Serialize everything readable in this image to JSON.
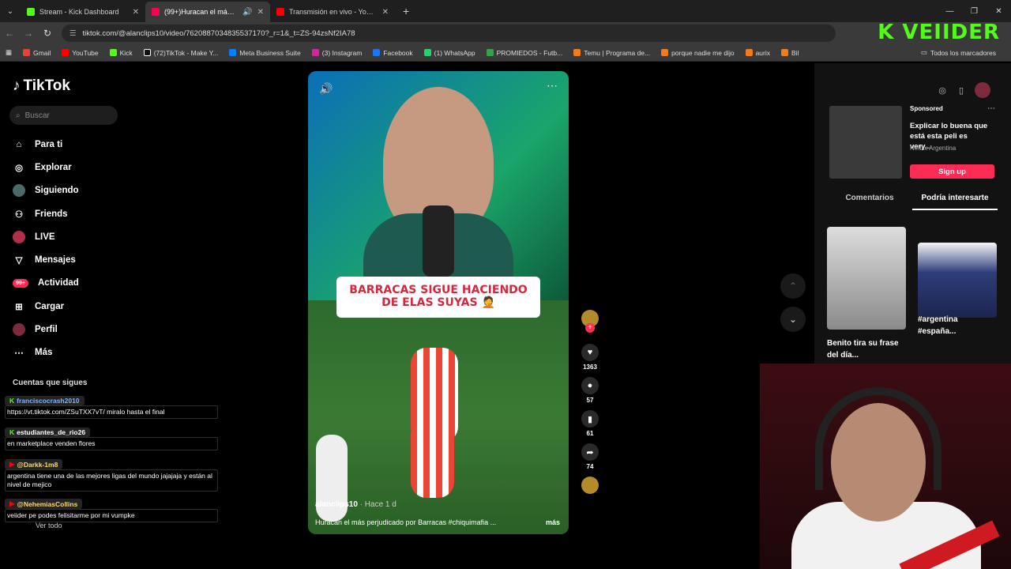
{
  "browser": {
    "tabs": [
      {
        "title": "Stream - Kick Dashboard",
        "color": "#53fc18",
        "active": false
      },
      {
        "title": "(99+)Huracan el más perju",
        "color": "#ff0050",
        "active": true
      },
      {
        "title": "Transmisión en vivo - YouTube",
        "color": "#ff0000",
        "active": false
      }
    ],
    "new_tab": "+",
    "url_host": "tiktok.com/@alanclips10/video/7620887034835537170?_r=1&_t=ZS-94zsNf2IA78",
    "bookmarks": [
      "Gmail",
      "YouTube",
      "Kick",
      "(72)TikTok - Make Y...",
      "Meta Business Suite",
      "(3) Instagram",
      "Facebook",
      "(1) WhatsApp",
      "PROMIEDOS - Futb...",
      "Temu | Programa de...",
      "porque nadie me dijo",
      "aurix",
      "Bil"
    ],
    "all_bookmarks": "Todos los marcadores",
    "overlay_logo": "K VEIIDER"
  },
  "tiktok": {
    "logo": "TikTok",
    "search_placeholder": "Buscar",
    "nav": [
      {
        "label": "Para ti",
        "icon": "home-icon"
      },
      {
        "label": "Explorar",
        "icon": "compass-icon"
      },
      {
        "label": "Siguiendo",
        "icon": "following-avatar-icon"
      },
      {
        "label": "Friends",
        "icon": "friends-icon"
      },
      {
        "label": "LIVE",
        "icon": "live-icon"
      },
      {
        "label": "Mensajes",
        "icon": "messages-icon"
      },
      {
        "label": "Actividad",
        "icon": "activity-icon",
        "badge": "99+"
      },
      {
        "label": "Cargar",
        "icon": "upload-icon"
      },
      {
        "label": "Perfil",
        "icon": "profile-icon"
      },
      {
        "label": "Más",
        "icon": "more-icon"
      }
    ],
    "following_header": "Cuentas que sigues",
    "see_all": "Ver todo"
  },
  "chat": [
    {
      "user": "franciscocrash2010",
      "msg": "https://vt.tiktok.com/ZSuTXX7vT/ miralo hasta el final"
    },
    {
      "user": "estudiantes_de_rio26",
      "msg": "en marketplace venden flores"
    },
    {
      "user": "@Darkk-1m8",
      "msg": "argentina tiene una de las mejores ligas del mundo jajajaja y están al nivel de mejico"
    },
    {
      "user": "@NehemiasCollins",
      "msg": "veiider pe podes felisitarme por mi vumpke"
    }
  ],
  "video": {
    "caption_line1": "BARRACAS SIGUE HACIENDO",
    "caption_line2": "DE ELAS SUYAS 🤦",
    "author": "alanclips10",
    "ago": "· Hace 1 d",
    "description": "Huracan el más perjudicado por Barracas #chiquimafia ...",
    "more": "más",
    "actions": {
      "likes": "1363",
      "comments": "57",
      "saves": "61",
      "shares": "74"
    }
  },
  "right_panel": {
    "sponsored": "Sponsored",
    "ad_title": "Explicar lo buena que está esta peli es very...",
    "ad_brand": "Netflix Argentina",
    "signup": "Sign up",
    "tabs": [
      "Comentarios",
      "Podría interesarte"
    ],
    "recs": [
      {
        "title": "Benito tira su frase del día..."
      },
      {
        "title": "#argentina #españa..."
      }
    ]
  }
}
